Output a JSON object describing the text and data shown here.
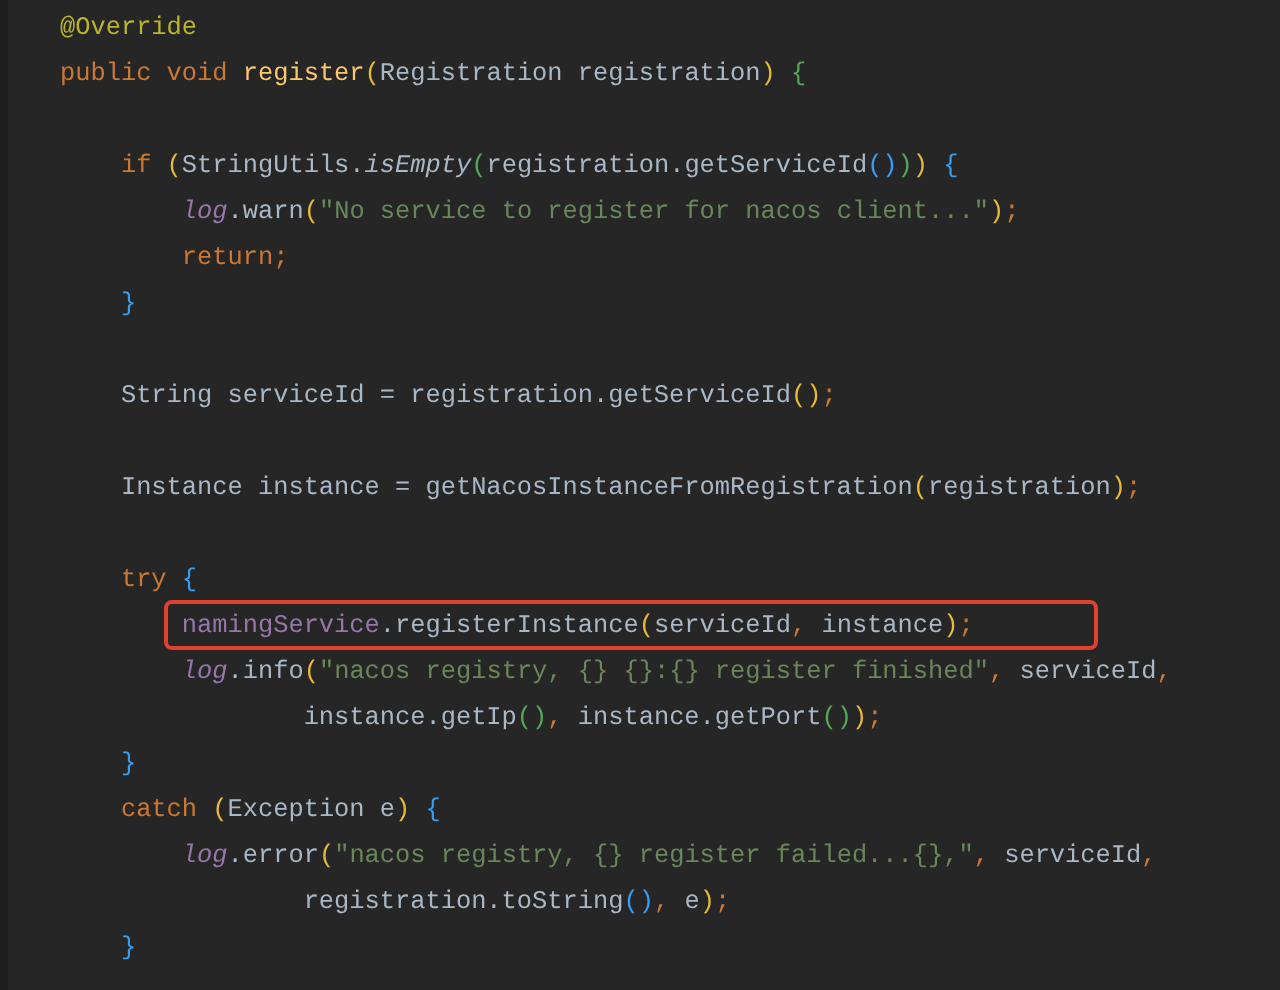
{
  "lines": [
    {
      "kind": "code",
      "highlighted": false,
      "tokens": [
        {
          "text": "@Override",
          "kind": "an"
        }
      ]
    },
    {
      "kind": "code",
      "highlighted": false,
      "tokens": [
        {
          "text": "public void ",
          "kind": "kw"
        },
        {
          "text": "register",
          "kind": "fn"
        },
        {
          "text": "(",
          "kind": "p1"
        },
        {
          "text": "Registration registration",
          "kind": "pl"
        },
        {
          "text": ")",
          "kind": "p1"
        },
        {
          "text": " {",
          "kind": "p2"
        }
      ]
    },
    {
      "kind": "blank"
    },
    {
      "kind": "code",
      "highlighted": false,
      "tokens": [
        {
          "text": "    if ",
          "kind": "kw"
        },
        {
          "text": "(",
          "kind": "p1"
        },
        {
          "text": "StringUtils.",
          "kind": "pl"
        },
        {
          "text": "isEmpty",
          "kind": "it"
        },
        {
          "text": "(",
          "kind": "p2"
        },
        {
          "text": "registration.getServiceId",
          "kind": "pl"
        },
        {
          "text": "()",
          "kind": "p3"
        },
        {
          "text": ")",
          "kind": "p2"
        },
        {
          "text": ")",
          "kind": "p1"
        },
        {
          "text": " {",
          "kind": "p3"
        }
      ]
    },
    {
      "kind": "code",
      "highlighted": false,
      "tokens": [
        {
          "text": "        log",
          "kind": "fld"
        },
        {
          "text": ".warn",
          "kind": "pl"
        },
        {
          "text": "(",
          "kind": "p1"
        },
        {
          "text": "\"No service to register for nacos client...\"",
          "kind": "str"
        },
        {
          "text": ")",
          "kind": "p1"
        },
        {
          "text": ";",
          "kind": "kw"
        }
      ]
    },
    {
      "kind": "code",
      "highlighted": false,
      "tokens": [
        {
          "text": "        return;",
          "kind": "kw"
        }
      ]
    },
    {
      "kind": "code",
      "highlighted": false,
      "tokens": [
        {
          "text": "    }",
          "kind": "p3"
        }
      ]
    },
    {
      "kind": "blank"
    },
    {
      "kind": "code",
      "highlighted": false,
      "tokens": [
        {
          "text": "    String serviceId = registration.getServiceId",
          "kind": "pl"
        },
        {
          "text": "()",
          "kind": "p1"
        },
        {
          "text": ";",
          "kind": "kw"
        }
      ]
    },
    {
      "kind": "blank"
    },
    {
      "kind": "code",
      "highlighted": false,
      "tokens": [
        {
          "text": "    Instance instance = getNacosInstanceFromRegistration",
          "kind": "pl"
        },
        {
          "text": "(",
          "kind": "p1"
        },
        {
          "text": "registration",
          "kind": "pl"
        },
        {
          "text": ")",
          "kind": "p1"
        },
        {
          "text": ";",
          "kind": "kw"
        }
      ]
    },
    {
      "kind": "blank"
    },
    {
      "kind": "code",
      "highlighted": false,
      "tokens": [
        {
          "text": "    try ",
          "kind": "kw"
        },
        {
          "text": "{",
          "kind": "p3"
        }
      ]
    },
    {
      "kind": "code",
      "highlighted": true,
      "tokens": [
        {
          "text": "        namingService",
          "kind": "fldn"
        },
        {
          "text": ".registerInstance",
          "kind": "pl"
        },
        {
          "text": "(",
          "kind": "p1"
        },
        {
          "text": "serviceId",
          "kind": "pl"
        },
        {
          "text": ", ",
          "kind": "kw"
        },
        {
          "text": "instance",
          "kind": "pl"
        },
        {
          "text": ")",
          "kind": "p1"
        },
        {
          "text": ";",
          "kind": "kw"
        }
      ]
    },
    {
      "kind": "code",
      "highlighted": false,
      "tokens": [
        {
          "text": "        log",
          "kind": "fld"
        },
        {
          "text": ".info",
          "kind": "pl"
        },
        {
          "text": "(",
          "kind": "p1"
        },
        {
          "text": "\"nacos registry, {} {}:{} register finished\"",
          "kind": "str"
        },
        {
          "text": ", ",
          "kind": "kw"
        },
        {
          "text": "serviceId",
          "kind": "pl"
        },
        {
          "text": ",",
          "kind": "kw"
        }
      ]
    },
    {
      "kind": "code",
      "highlighted": false,
      "tokens": [
        {
          "text": "                instance.getIp",
          "kind": "pl"
        },
        {
          "text": "()",
          "kind": "p2"
        },
        {
          "text": ", ",
          "kind": "kw"
        },
        {
          "text": "instance.getPort",
          "kind": "pl"
        },
        {
          "text": "()",
          "kind": "p2"
        },
        {
          "text": ")",
          "kind": "p1"
        },
        {
          "text": ";",
          "kind": "kw"
        }
      ]
    },
    {
      "kind": "code",
      "highlighted": false,
      "tokens": [
        {
          "text": "    }",
          "kind": "p3"
        }
      ]
    },
    {
      "kind": "code",
      "highlighted": false,
      "tokens": [
        {
          "text": "    catch ",
          "kind": "kw"
        },
        {
          "text": "(",
          "kind": "p1"
        },
        {
          "text": "Exception e",
          "kind": "pl"
        },
        {
          "text": ")",
          "kind": "p1"
        },
        {
          "text": " {",
          "kind": "p3"
        }
      ]
    },
    {
      "kind": "code",
      "highlighted": false,
      "tokens": [
        {
          "text": "        log",
          "kind": "fld"
        },
        {
          "text": ".error",
          "kind": "pl"
        },
        {
          "text": "(",
          "kind": "p1"
        },
        {
          "text": "\"nacos registry, {} register failed...{},\"",
          "kind": "str"
        },
        {
          "text": ", ",
          "kind": "kw"
        },
        {
          "text": "serviceId",
          "kind": "pl"
        },
        {
          "text": ",",
          "kind": "kw"
        }
      ]
    },
    {
      "kind": "code",
      "highlighted": false,
      "tokens": [
        {
          "text": "                registration.toString",
          "kind": "pl"
        },
        {
          "text": "()",
          "kind": "p3"
        },
        {
          "text": ", ",
          "kind": "kw"
        },
        {
          "text": "e",
          "kind": "pl"
        },
        {
          "text": ")",
          "kind": "p1"
        },
        {
          "text": ";",
          "kind": "kw"
        }
      ]
    },
    {
      "kind": "code",
      "highlighted": false,
      "tokens": [
        {
          "text": "    }",
          "kind": "p3"
        }
      ]
    }
  ]
}
